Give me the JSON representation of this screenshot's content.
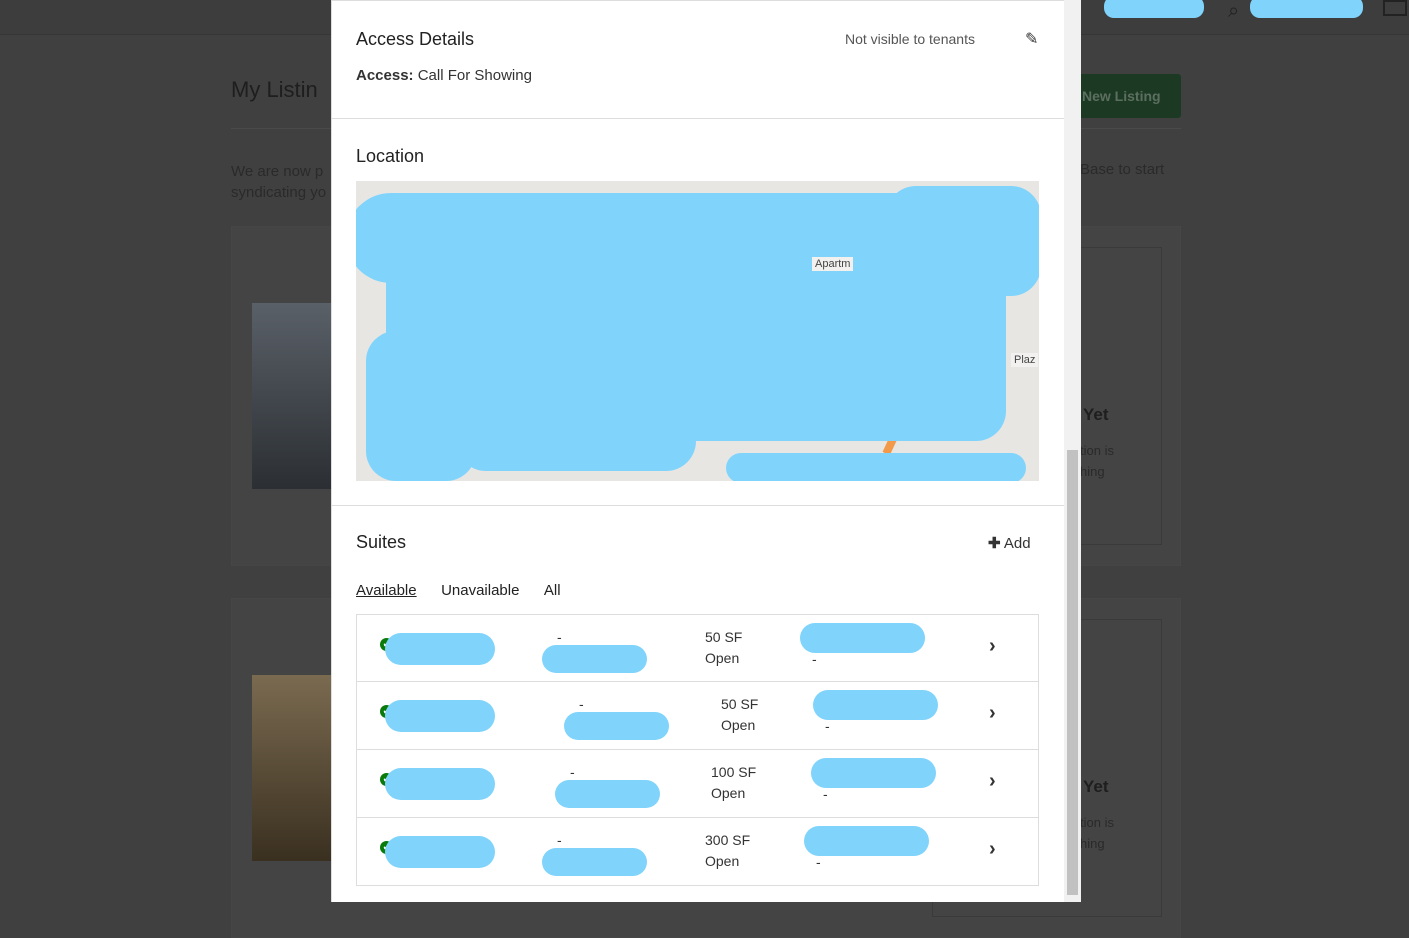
{
  "background": {
    "title": "My Listin",
    "intro_line1": "We are now p",
    "intro_line2": "syndicating yo",
    "intro_right": "Base to start",
    "new_listing": "New Listing",
    "card_heading": "Yet",
    "card_text1": "tion is",
    "card_text2": "hing"
  },
  "access": {
    "title": "Access Details",
    "visibility": "Not visible to tenants",
    "label": "Access:",
    "value": "Call For Showing"
  },
  "location": {
    "title": "Location",
    "map_labels": [
      "Apartm",
      "Plaz"
    ]
  },
  "suites": {
    "title": "Suites",
    "add": "Add",
    "tabs": [
      "Available",
      "Unavailable",
      "All"
    ],
    "active_tab": "Available",
    "rows": [
      {
        "dash1": "-",
        "size": "50 SF",
        "status": "Open",
        "dash2": "-"
      },
      {
        "dash1": "-",
        "size": "50 SF",
        "status": "Open",
        "dash2": "-"
      },
      {
        "dash1": "-",
        "size": "100 SF",
        "status": "Open",
        "dash2": "-"
      },
      {
        "dash1": "-",
        "size": "300 SF",
        "status": "Open",
        "dash2": "-"
      }
    ]
  },
  "colors": {
    "overlay": "#404040",
    "redaction": "#80d4fc",
    "check": "#0a7a0a",
    "button": "#1c3a23"
  }
}
